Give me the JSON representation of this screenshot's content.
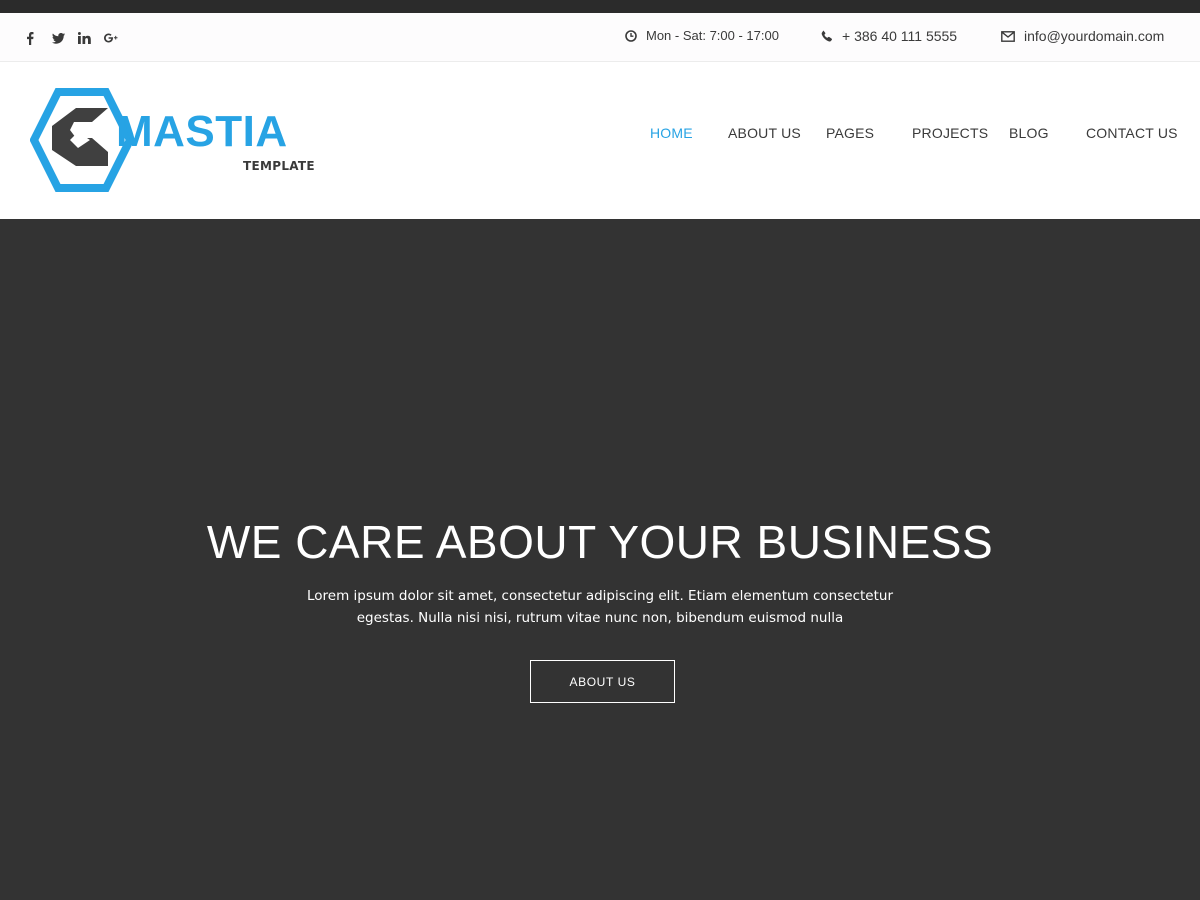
{
  "topbar": {
    "social": [
      "facebook-icon",
      "twitter-icon",
      "linkedin-icon",
      "google-plus-icon"
    ],
    "hours": "Mon - Sat: 7:00 - 17:00",
    "phone": "+ 386 40 111 5555",
    "email": "info@yourdomain.com"
  },
  "logo": {
    "name": "MASTIA",
    "subtitle": "TEMPLATE",
    "color": "#27a3e4"
  },
  "nav": {
    "items": [
      {
        "label": "HOME",
        "active": true
      },
      {
        "label": "ABOUT US",
        "active": false
      },
      {
        "label": "PAGES",
        "active": false
      },
      {
        "label": "PROJECTS",
        "active": false
      },
      {
        "label": "BLOG",
        "active": false
      },
      {
        "label": "CONTACT US",
        "active": false
      }
    ]
  },
  "hero": {
    "title": "WE CARE ABOUT YOUR BUSINESS",
    "text": "Lorem ipsum dolor sit amet, consectetur adipiscing elit. Etiam elementum consectetur egestas. Nulla nisi nisi, rutrum vitae nunc non, bibendum euismod nulla",
    "button_label": "ABOUT US",
    "background_color": "#333333"
  },
  "colors": {
    "accent": "#27a3e4",
    "text_dark": "#3a3a3a"
  }
}
